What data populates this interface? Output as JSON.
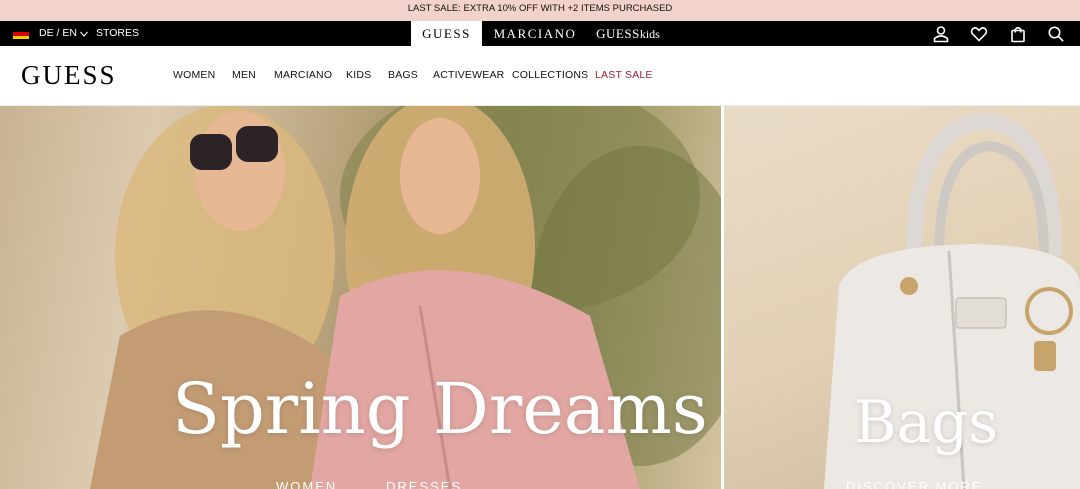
{
  "promo": {
    "text": "LAST SALE: EXTRA 10% OFF WITH +2 ITEMS PURCHASED"
  },
  "topbar": {
    "language": "DE / EN",
    "stores": "STORES",
    "brand_tabs": [
      {
        "label": "GUESS"
      },
      {
        "label": "MARCIANO"
      },
      {
        "label": "GUESS",
        "suffix": "kids"
      }
    ],
    "icons": [
      "account-icon",
      "wishlist-heart-icon",
      "shopping-bag-icon",
      "search-icon"
    ]
  },
  "nav": {
    "logo": "GUESS",
    "items": [
      {
        "label": "WOMEN"
      },
      {
        "label": "MEN"
      },
      {
        "label": "MARCIANO"
      },
      {
        "label": "KIDS"
      },
      {
        "label": "BAGS"
      },
      {
        "label": "ACTIVEWEAR"
      },
      {
        "label": "COLLECTIONS"
      },
      {
        "label": "LAST SALE"
      }
    ]
  },
  "hero_left": {
    "title": "Spring Dreams",
    "links": [
      "WOMEN",
      "DRESSES"
    ]
  },
  "hero_right": {
    "title": "Bags",
    "link": "DISCOVER MORE"
  },
  "colors": {
    "promo_bg": "#f3d2cb",
    "topbar_bg": "#000000",
    "sale_red": "#9c1f33"
  }
}
